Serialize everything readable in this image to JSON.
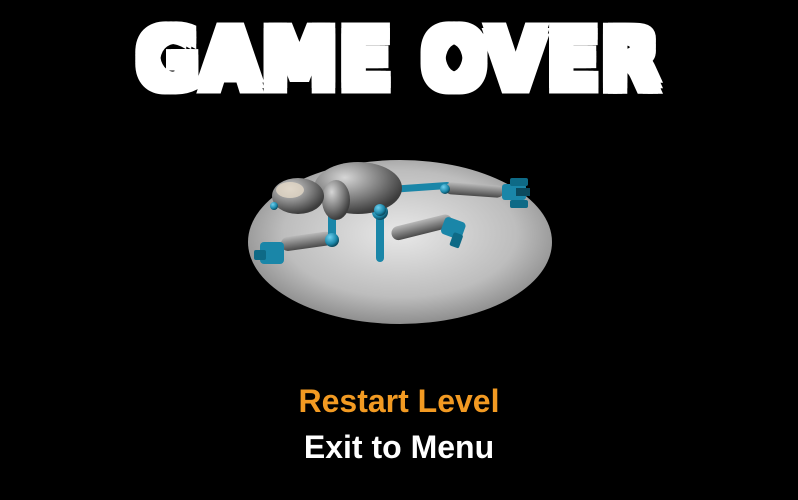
{
  "title": "GAME OVER",
  "menu": {
    "items": [
      {
        "label": "Restart Level",
        "selected": true
      },
      {
        "label": "Exit to Menu",
        "selected": false
      }
    ]
  },
  "colors": {
    "background": "#000000",
    "selected": "#f29a22",
    "normal": "#ffffff",
    "robot_body": "#8a8a8a",
    "robot_joints": "#1f8fb0",
    "spotlight": "#c8c8c8"
  },
  "illustration": "robot-wreck-icon"
}
